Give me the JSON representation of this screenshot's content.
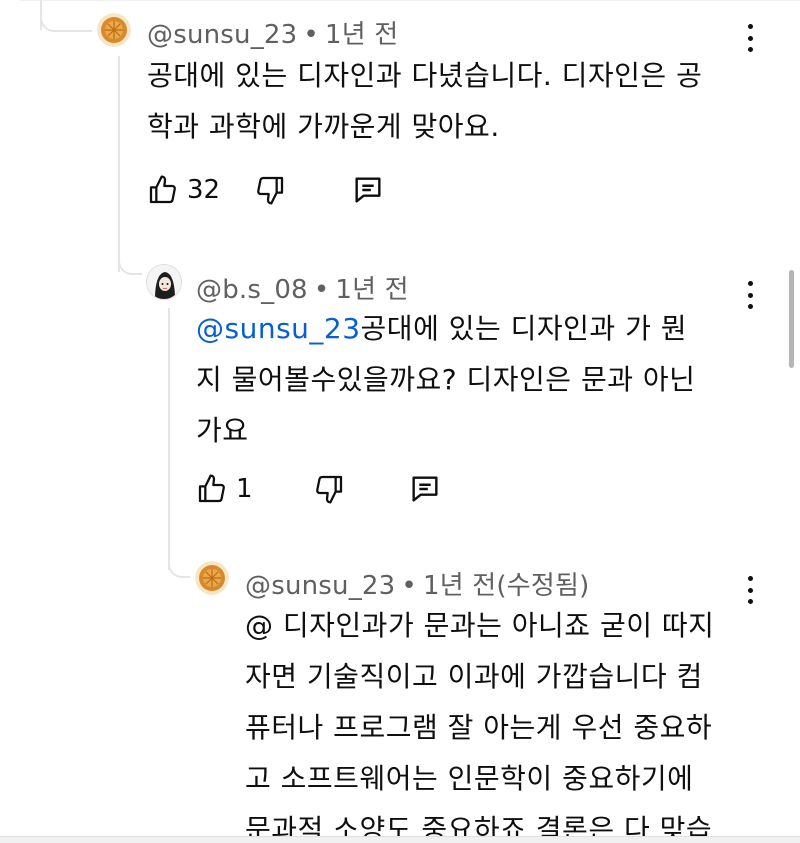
{
  "comments": [
    {
      "author": "@sunsu_23",
      "time": "1년 전",
      "body_lines": [
        "공대에 있는 디자인과 다녔습니다. 디자인은 공",
        "학과 과학에 가까운게 맞아요."
      ],
      "likes": "32"
    },
    {
      "author": "@b.s_08",
      "time": "1년 전",
      "mention": "@sunsu_23",
      "body_lines": [
        "공대에 있는 디자인과 가 뭔",
        "지 물어볼수있을까요? 디자인은 문과 아닌",
        "가요"
      ],
      "likes": "1"
    },
    {
      "author": "@sunsu_23",
      "time": "1년 전(수정됨)",
      "body_lines": [
        "@ 디자인과가 문과는 아니죠 굳이 따지",
        "자면 기술직이고 이과에 가깝습니다 컴",
        "퓨터나 프로그램 잘 아는게 우선 중요하",
        "고 소프트웨어는 인문학이 중요하기에",
        "문과적 소양도 중요하죠 결론은 다 맞습"
      ]
    }
  ],
  "separator": "•",
  "icons": [
    "like-icon",
    "dislike-icon",
    "reply-icon",
    "more-vert-icon"
  ],
  "colors": {
    "text": "#0f0f0f",
    "meta": "#606060",
    "mention": "#065fd4",
    "line": "#e5e5e5"
  }
}
